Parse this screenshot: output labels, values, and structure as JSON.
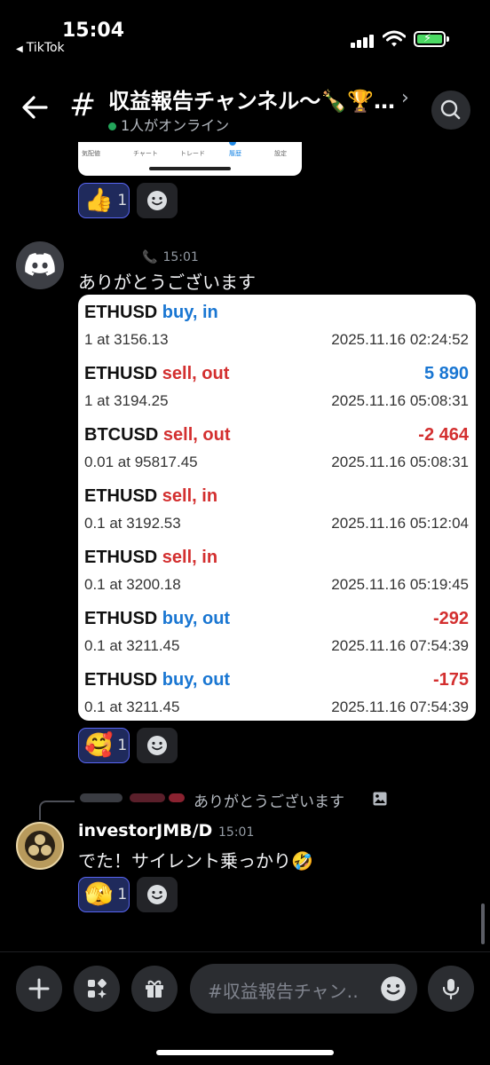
{
  "status_bar": {
    "time": "15:04",
    "back_app": "TikTok",
    "back_app_icon": "back-triangle-icon"
  },
  "header": {
    "channel_icon": "#",
    "title": "収益報告チャンネル〜🍾🏆…",
    "chevron": "›",
    "online_status": "1人がオンライン"
  },
  "prev_image": {
    "tabs": [
      "気配値",
      "チャート",
      "トレード",
      "履歴",
      "設定"
    ]
  },
  "reactions_top": [
    {
      "emoji": "👍",
      "count": "1"
    }
  ],
  "message1": {
    "time": "15:01",
    "text": "ありがとうございます",
    "trades": [
      {
        "symbol": "ETHUSD",
        "side": "buy, in",
        "side_type": "buy",
        "profit": "",
        "volume_price": "1 at 3156.13",
        "timestamp": "2025.11.16 02:24:52"
      },
      {
        "symbol": "ETHUSD",
        "side": "sell, out",
        "side_type": "sell",
        "profit": "5 890",
        "profit_sign": "pos",
        "volume_price": "1 at 3194.25",
        "timestamp": "2025.11.16 05:08:31"
      },
      {
        "symbol": "BTCUSD",
        "side": "sell, out",
        "side_type": "sell",
        "profit": "-2 464",
        "profit_sign": "neg",
        "volume_price": "0.01 at 95817.45",
        "timestamp": "2025.11.16 05:08:31"
      },
      {
        "symbol": "ETHUSD",
        "side": "sell, in",
        "side_type": "sell",
        "profit": "",
        "volume_price": "0.1 at 3192.53",
        "timestamp": "2025.11.16 05:12:04"
      },
      {
        "symbol": "ETHUSD",
        "side": "sell, in",
        "side_type": "sell",
        "profit": "",
        "volume_price": "0.1 at 3200.18",
        "timestamp": "2025.11.16 05:19:45"
      },
      {
        "symbol": "ETHUSD",
        "side": "buy, out",
        "side_type": "buy",
        "profit": "-292",
        "profit_sign": "neg",
        "volume_price": "0.1 at 3211.45",
        "timestamp": "2025.11.16 07:54:39"
      },
      {
        "symbol": "ETHUSD",
        "side": "buy, out",
        "side_type": "buy",
        "profit": "-175",
        "profit_sign": "neg",
        "volume_price": "0.1 at 3211.45",
        "timestamp": "2025.11.16 07:54:39"
      }
    ],
    "reaction": {
      "emoji": "🥰",
      "count": "1"
    }
  },
  "reply": {
    "text": "ありがとうございます",
    "icon": "image-icon"
  },
  "message2": {
    "author": "investorJMB/D",
    "time": "15:01",
    "text": "でた！サイレント乗っかり🤣",
    "reaction": {
      "emoji": "🫣",
      "count": "1"
    }
  },
  "composer": {
    "placeholder": "#収益報告チャン‥"
  },
  "colors": {
    "background": "#000000",
    "reaction_bg": "#1f2a5c",
    "reaction_border": "#5865f2",
    "buy": "#1976d2",
    "sell": "#d32f2f",
    "online": "#23a55a"
  }
}
